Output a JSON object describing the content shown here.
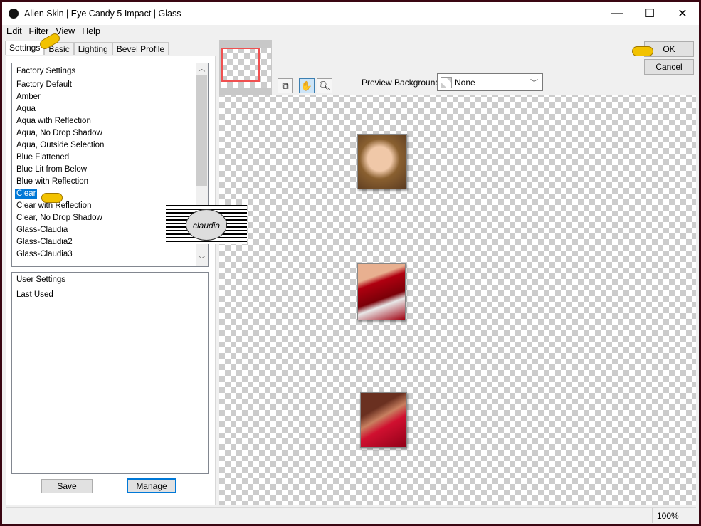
{
  "window": {
    "title": "Alien Skin | Eye Candy 5 Impact | Glass",
    "minimize": "—",
    "maximize": "☐",
    "close": "✕"
  },
  "menu": [
    "Edit",
    "Filter",
    "View",
    "Help"
  ],
  "tabs": [
    "Settings",
    "Basic",
    "Lighting",
    "Bevel Profile"
  ],
  "factory": {
    "header": "Factory Settings",
    "items": [
      "Factory Default",
      "Amber",
      "Aqua",
      "Aqua with Reflection",
      "Aqua, No Drop Shadow",
      "Aqua, Outside Selection",
      "Blue Flattened",
      "Blue Lit from Below",
      "Blue with Reflection",
      "Clear",
      "Clear with Reflection",
      "Clear, No Drop Shadow",
      "Glass-Claudia",
      "Glass-Claudia2",
      "Glass-Claudia3"
    ],
    "selected": "Clear"
  },
  "user": {
    "header": "User Settings",
    "items": [
      "Last Used"
    ]
  },
  "buttons": {
    "save": "Save",
    "manage": "Manage",
    "ok": "OK",
    "cancel": "Cancel"
  },
  "preview": {
    "background_label": "Preview Background:",
    "background_value": "None"
  },
  "status": {
    "zoom": "100%"
  },
  "watermark": "claudia",
  "colors": {
    "selection": "#0078d7",
    "frame": "#3a0612"
  }
}
